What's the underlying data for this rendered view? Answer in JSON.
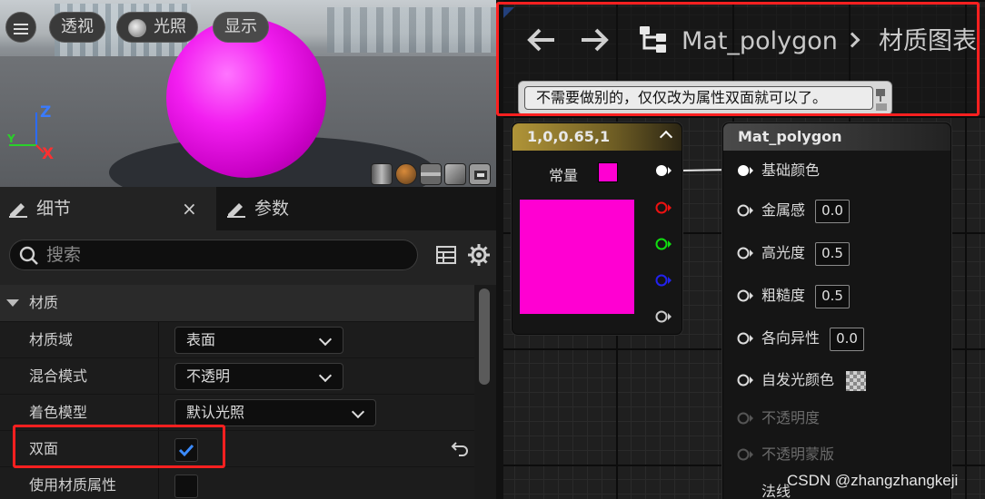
{
  "viewport": {
    "perspective_label": "透视",
    "lit_label": "光照",
    "show_label": "显示",
    "axis_x": "X",
    "axis_y": "Y",
    "axis_z": "Z",
    "sphere_color": "#f21ef0"
  },
  "details": {
    "tab_details": "细节",
    "tab_close": "×",
    "tab_params": "参数",
    "search_placeholder": "搜索",
    "section": "材质",
    "rows": [
      {
        "label": "材质域",
        "value": "表面"
      },
      {
        "label": "混合模式",
        "value": "不透明"
      },
      {
        "label": "着色模型",
        "value": "默认光照"
      },
      {
        "label": "双面",
        "checked": true
      },
      {
        "label": "使用材质属性",
        "checked": false
      }
    ]
  },
  "graph": {
    "breadcrumb_asset": "Mat_polygon",
    "breadcrumb_page": "材质图表",
    "comment": "不需要做别的，仅仅改为属性双面就可以了。",
    "constant_node": {
      "title": "1,0,0.65,1",
      "label": "常量",
      "color": "#ff00d2"
    },
    "material_node": {
      "title": "Mat_polygon",
      "pins": [
        {
          "label": "基础颜色"
        },
        {
          "label": "金属感",
          "value": "0.0"
        },
        {
          "label": "高光度",
          "value": "0.5"
        },
        {
          "label": "粗糙度",
          "value": "0.5"
        },
        {
          "label": "各向异性",
          "value": "0.0"
        },
        {
          "label": "自发光颜色"
        },
        {
          "label": "不透明度"
        },
        {
          "label": "不透明蒙版"
        },
        {
          "label": "法线"
        }
      ]
    }
  },
  "watermark": "CSDN @zhangzhangkeji",
  "highlight_color": "#ff2020"
}
